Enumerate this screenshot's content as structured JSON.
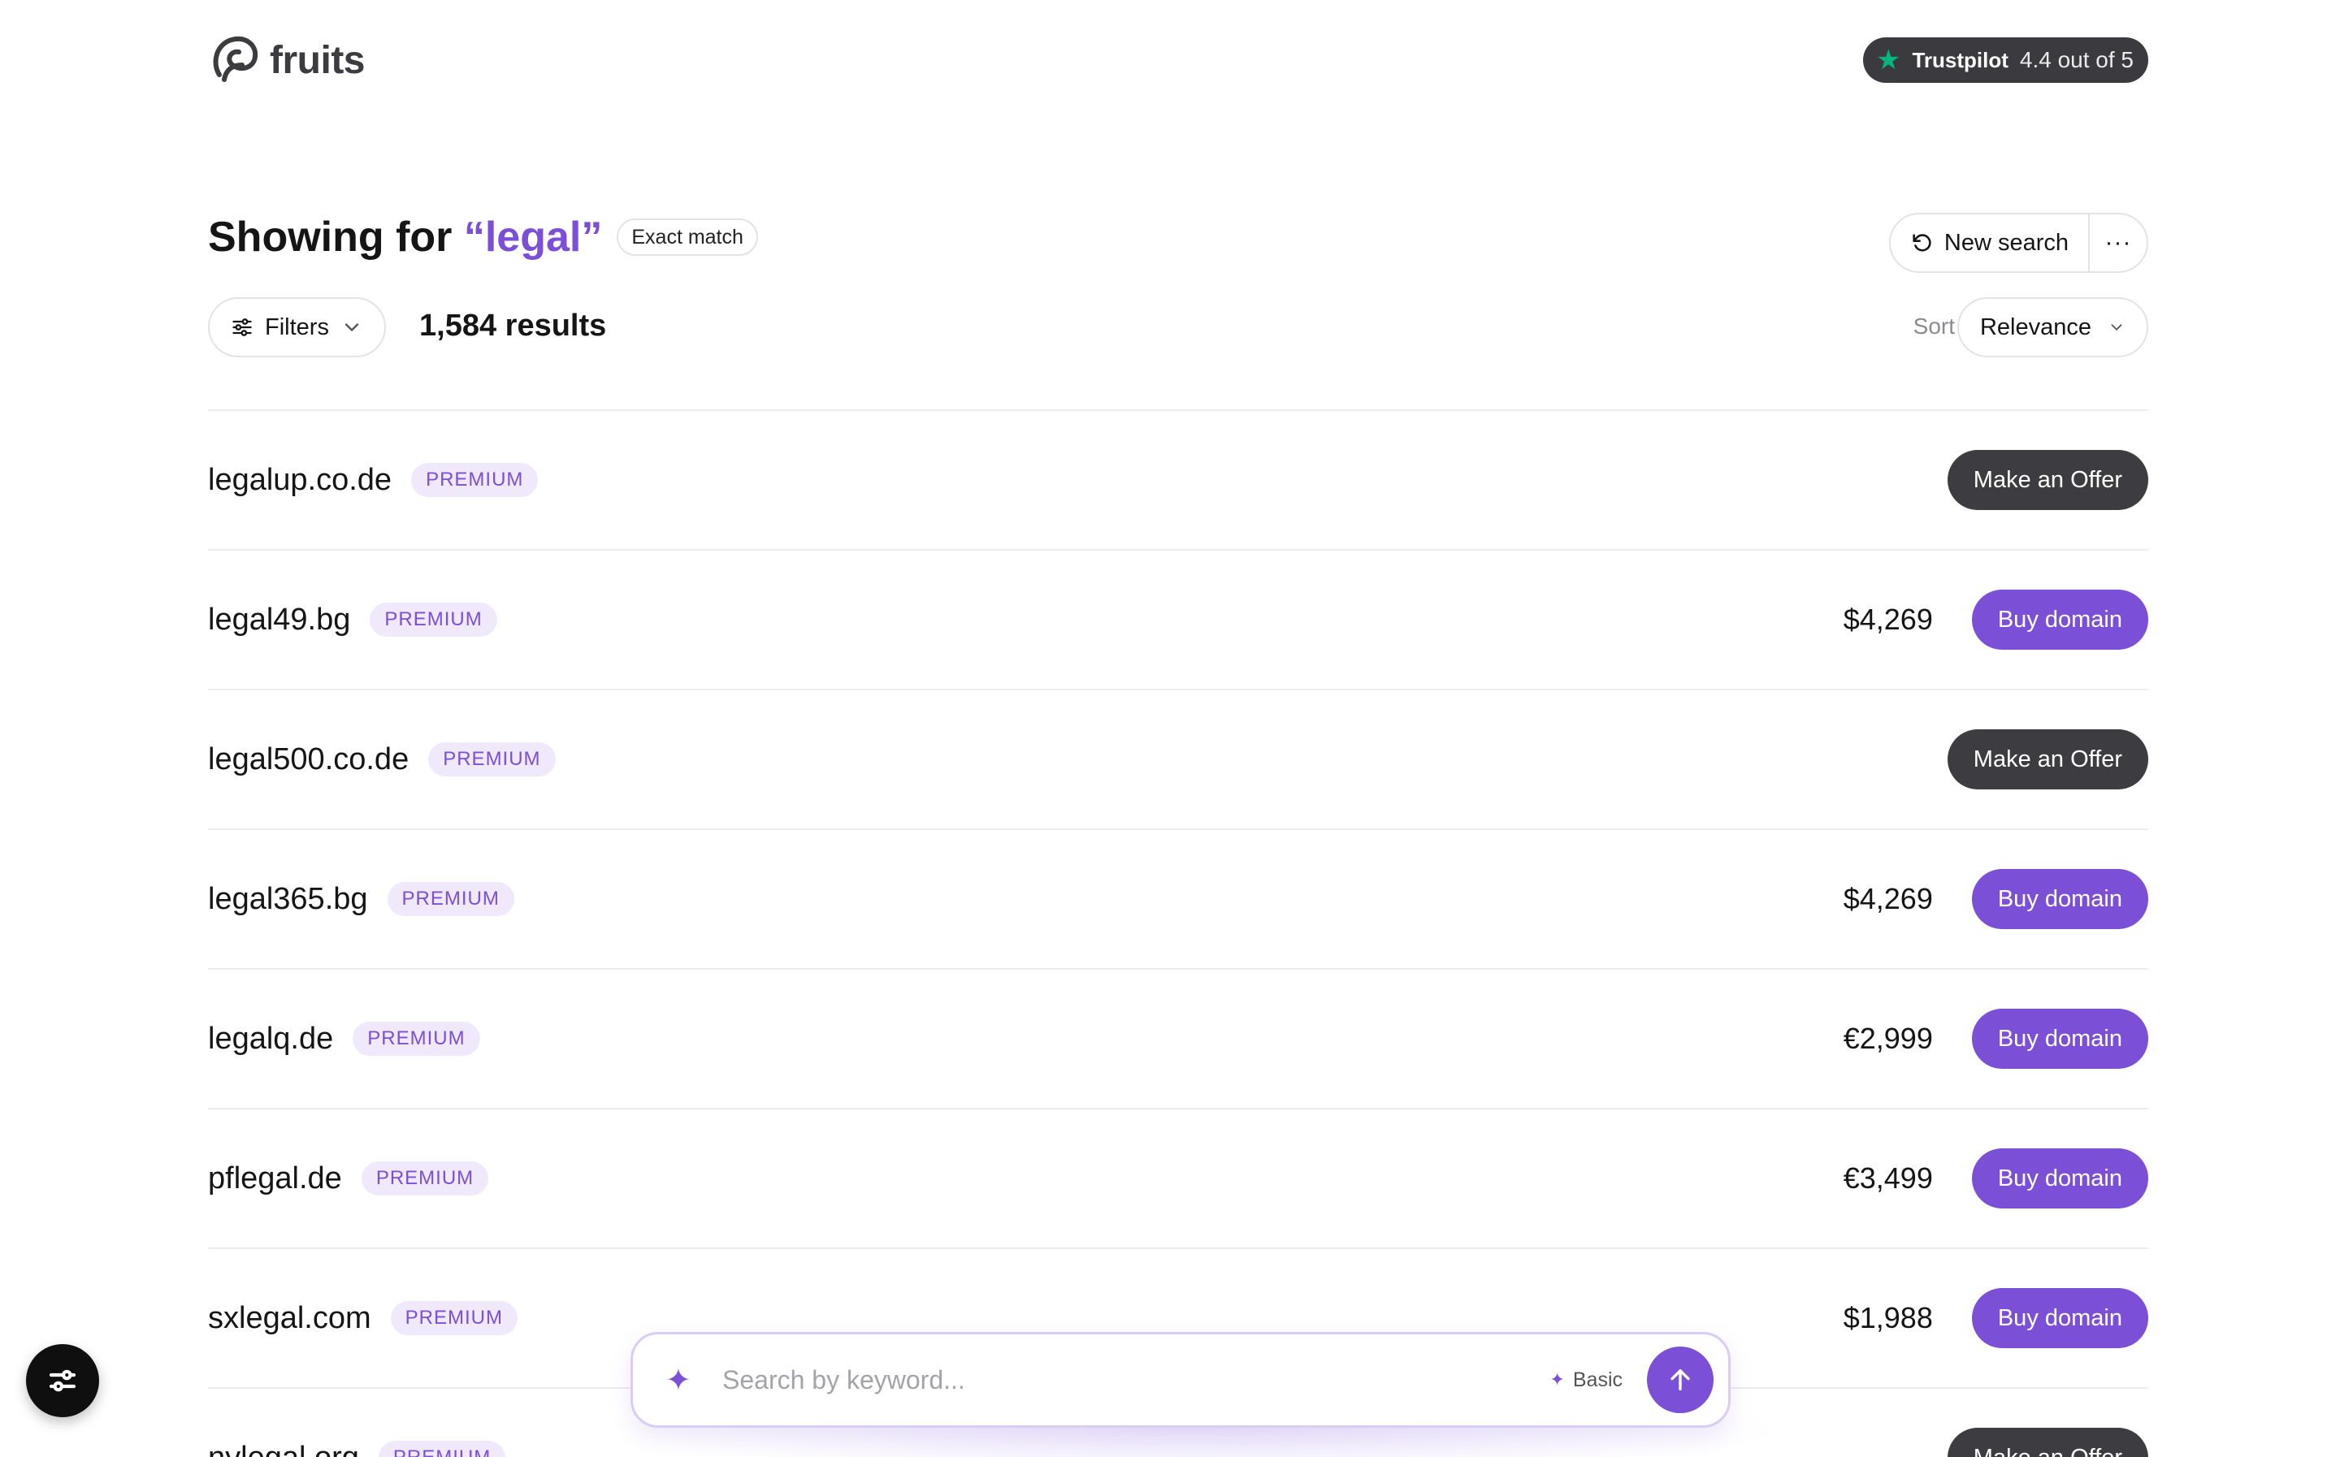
{
  "brand": {
    "name": "fruits"
  },
  "trustpilot": {
    "brand": "Trustpilot",
    "rating": "4.4 out of 5"
  },
  "search_header": {
    "prefix": "Showing for",
    "query": "“legal”",
    "match_chip": "Exact match",
    "new_search_label": "New search",
    "more_label": "···"
  },
  "filters": {
    "label": "Filters"
  },
  "results": {
    "count_text": "1,584 results"
  },
  "sort": {
    "label": "Sort",
    "value": "Relevance"
  },
  "domains": [
    {
      "name": "legalup.co.de",
      "badge": "PREMIUM",
      "price": "",
      "action": "Make an Offer"
    },
    {
      "name": "legal49.bg",
      "badge": "PREMIUM",
      "price": "$4,269",
      "action": "Buy domain"
    },
    {
      "name": "legal500.co.de",
      "badge": "PREMIUM",
      "price": "",
      "action": "Make an Offer"
    },
    {
      "name": "legal365.bg",
      "badge": "PREMIUM",
      "price": "$4,269",
      "action": "Buy domain"
    },
    {
      "name": "legalq.de",
      "badge": "PREMIUM",
      "price": "€2,999",
      "action": "Buy domain"
    },
    {
      "name": "pflegal.de",
      "badge": "PREMIUM",
      "price": "€3,499",
      "action": "Buy domain"
    },
    {
      "name": "sxlegal.com",
      "badge": "PREMIUM",
      "price": "$1,988",
      "action": "Buy domain"
    },
    {
      "name": "nylegal.org",
      "badge": "PREMIUM",
      "price": "",
      "action": "Make an Offer"
    }
  ],
  "search_bar": {
    "placeholder": "Search by keyword...",
    "mode": "Basic"
  },
  "colors": {
    "accent": "#7b4fd6",
    "dark_button": "#3c3c41",
    "badge_bg": "#efe9fb",
    "trustpilot_star": "#00b67a"
  }
}
